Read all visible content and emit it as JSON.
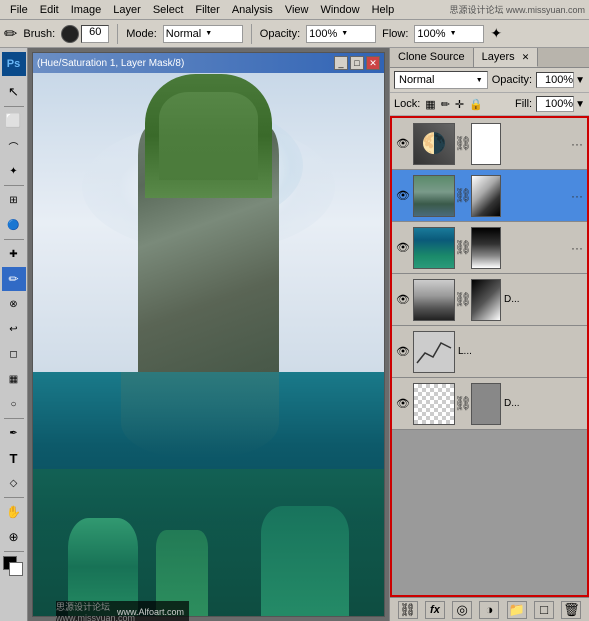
{
  "app": {
    "title": "Photoshop"
  },
  "menu": {
    "items": [
      "File",
      "Edit",
      "Image",
      "Layer",
      "Select",
      "Filter",
      "Analysis",
      "View",
      "Window",
      "Help",
      "思源设计论坛 www.missyuan.com"
    ]
  },
  "options_bar": {
    "brush_label": "Brush:",
    "brush_size": "60",
    "mode_label": "Mode:",
    "mode_value": "Normal",
    "opacity_label": "Opacity:",
    "opacity_value": "100%",
    "flow_label": "Flow:",
    "flow_value": "100%"
  },
  "canvas": {
    "title": "(Hue/Saturation 1, Layer Mask/8)",
    "watermark": "思源设计论坛 www.missyuan.com",
    "watermark_right": "www.Alfoart.com"
  },
  "layers_panel": {
    "tabs": [
      {
        "label": "Clone Source",
        "active": false
      },
      {
        "label": "Layers",
        "active": true
      }
    ],
    "mode": "Normal",
    "opacity_label": "Opacity:",
    "opacity_value": "100%",
    "lock_label": "Lock:",
    "fill_label": "Fill:",
    "fill_value": "100%",
    "layers": [
      {
        "id": 1,
        "visible": true,
        "thumb_type": "hue",
        "has_mask": true,
        "mask_type": "white",
        "name": "",
        "selected": false
      },
      {
        "id": 2,
        "visible": true,
        "thumb_type": "island",
        "has_mask": true,
        "mask_type": "white-shape",
        "name": "",
        "selected": true
      },
      {
        "id": 3,
        "visible": true,
        "thumb_type": "ocean",
        "has_mask": true,
        "mask_type": "dark-mask",
        "name": "",
        "selected": false
      },
      {
        "id": 4,
        "visible": true,
        "thumb_type": "mountain",
        "has_mask": true,
        "mask_type": "dark-shape",
        "name": "D...",
        "selected": false
      },
      {
        "id": 5,
        "visible": true,
        "thumb_type": "mountain-icon",
        "has_mask": false,
        "mask_type": "",
        "name": "L...",
        "selected": false
      },
      {
        "id": 6,
        "visible": true,
        "thumb_type": "checker",
        "has_mask": true,
        "mask_type": "white-shape2",
        "name": "D...",
        "selected": false
      }
    ],
    "footer_buttons": [
      "link-icon",
      "fx-icon",
      "mask-icon",
      "adjustment-icon",
      "folder-icon",
      "new-icon",
      "trash-icon"
    ]
  },
  "toolbox": {
    "tools": [
      {
        "name": "move",
        "icon": "↖",
        "active": false
      },
      {
        "name": "select-rect",
        "icon": "⬜",
        "active": false
      },
      {
        "name": "lasso",
        "icon": "⊙",
        "active": false
      },
      {
        "name": "magic-wand",
        "icon": "✦",
        "active": false
      },
      {
        "name": "crop",
        "icon": "⊞",
        "active": false
      },
      {
        "name": "eyedropper",
        "icon": "✒",
        "active": false
      },
      {
        "name": "healing",
        "icon": "✚",
        "active": false
      },
      {
        "name": "brush",
        "icon": "✏",
        "active": true
      },
      {
        "name": "clone-stamp",
        "icon": "⊗",
        "active": false
      },
      {
        "name": "eraser",
        "icon": "◻",
        "active": false
      },
      {
        "name": "gradient",
        "icon": "▦",
        "active": false
      },
      {
        "name": "dodge",
        "icon": "○",
        "active": false
      },
      {
        "name": "pen",
        "icon": "✒",
        "active": false
      },
      {
        "name": "type",
        "icon": "T",
        "active": false
      },
      {
        "name": "shape",
        "icon": "◇",
        "active": false
      },
      {
        "name": "hand",
        "icon": "✋",
        "active": false
      },
      {
        "name": "zoom",
        "icon": "⊕",
        "active": false
      }
    ]
  }
}
